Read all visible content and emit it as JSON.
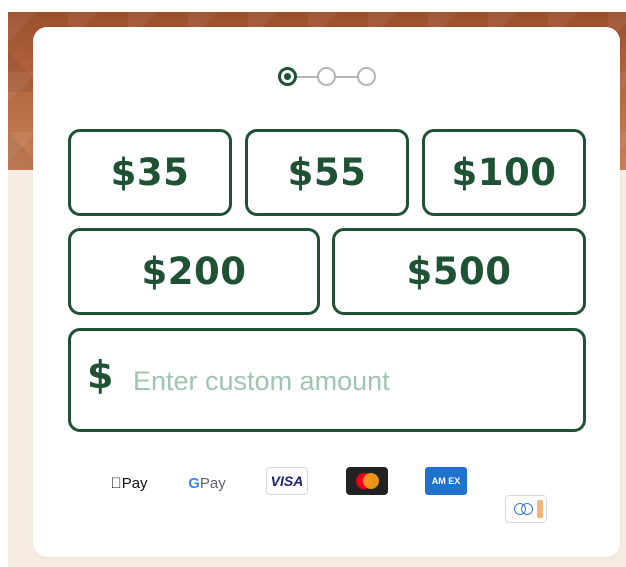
{
  "stepper": {
    "steps": 3,
    "current_step": 1
  },
  "amounts": {
    "row1": [
      "$35",
      "$55",
      "$100"
    ],
    "row2": [
      "$200",
      "$500"
    ]
  },
  "custom_amount": {
    "currency_symbol": "$",
    "placeholder": "Enter custom amount",
    "value": ""
  },
  "payment_methods": {
    "apple_pay": "Pay",
    "google_pay_g": "G",
    "google_pay": "Pay",
    "visa": "VISA",
    "mastercard": "mastercard-icon",
    "amex": "AM EX",
    "diners": "diners-club-icon"
  },
  "colors": {
    "primary": "#1f5234",
    "placeholder": "#9fc4b0",
    "header_bg": "#b5673f",
    "page_bg": "#f8ede2"
  }
}
